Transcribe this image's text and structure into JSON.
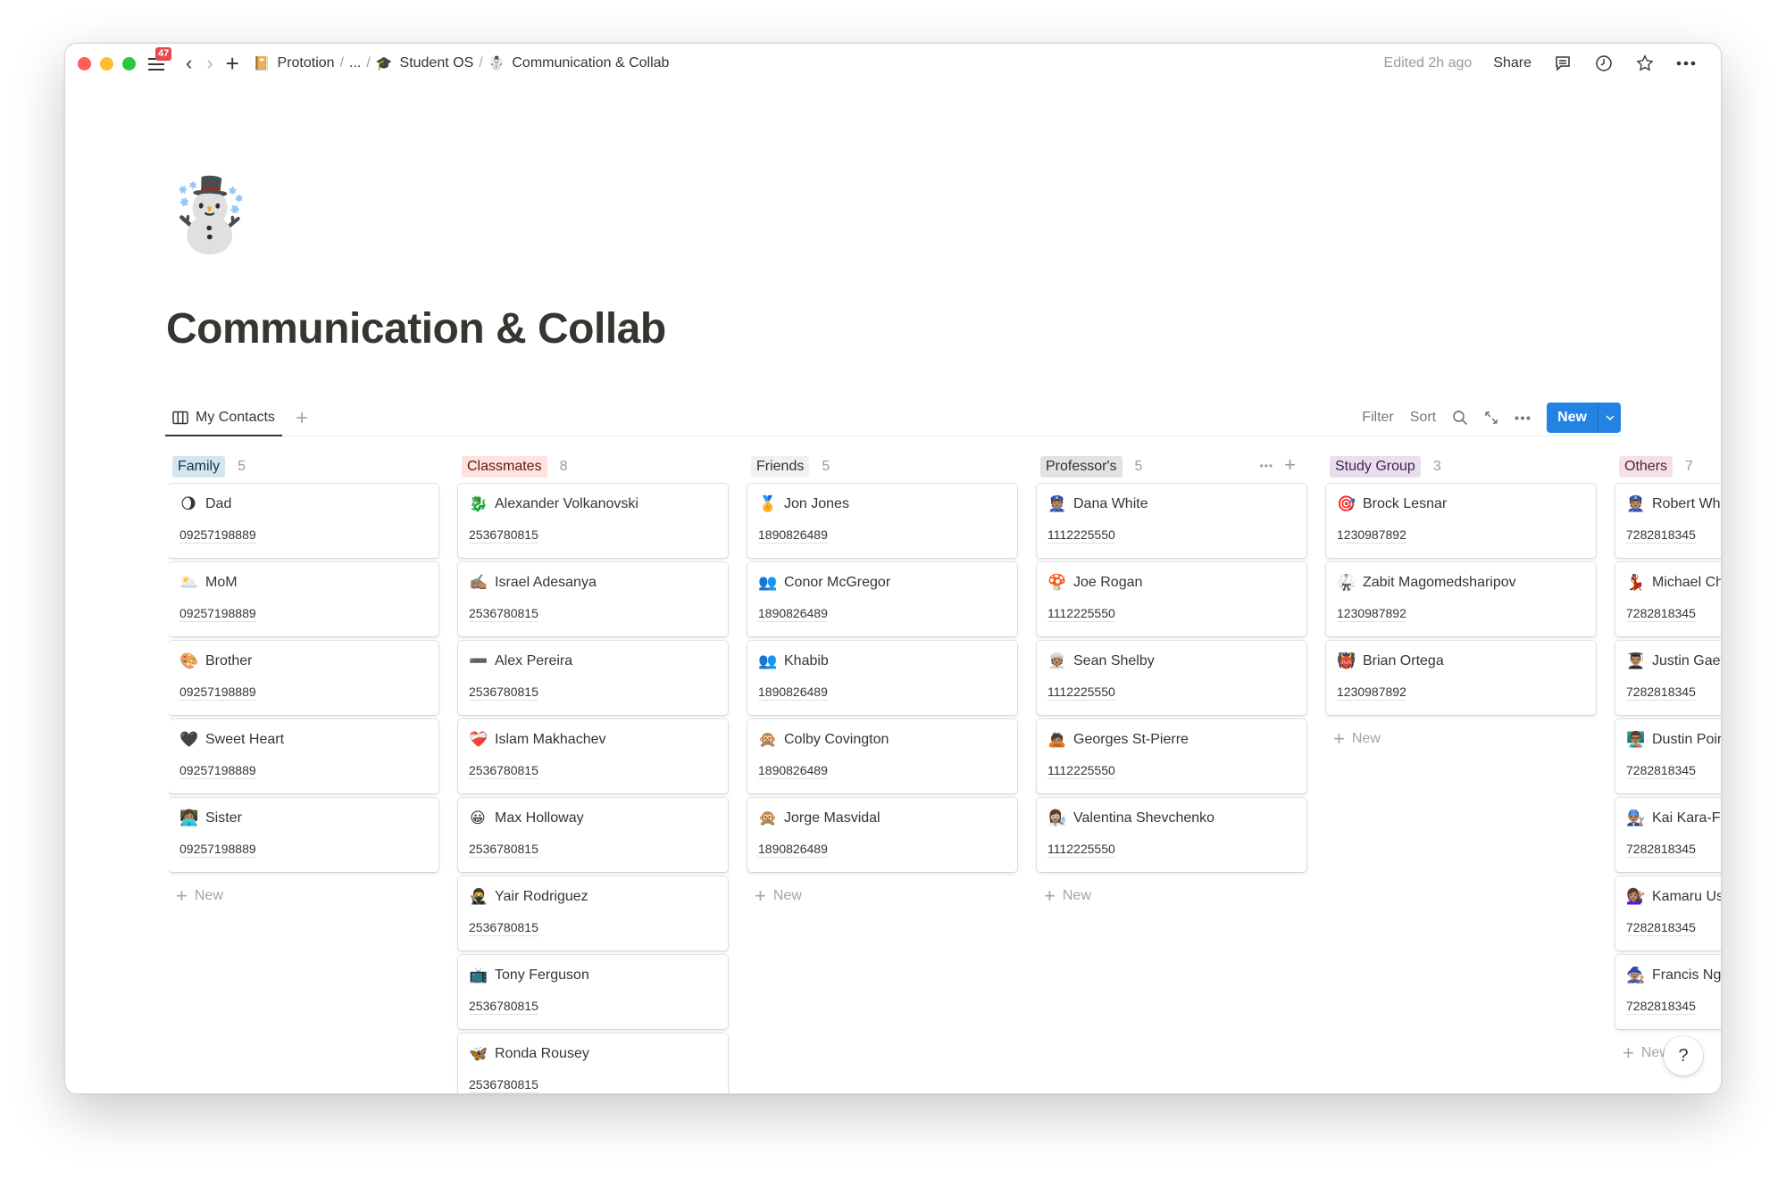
{
  "titlebar": {
    "notification_count": "47",
    "breadcrumb": [
      {
        "icon": "📔",
        "label": "Prototion"
      },
      {
        "icon": "",
        "label": "..."
      },
      {
        "icon": "🎓",
        "label": "Student OS"
      },
      {
        "icon": "☃️",
        "label": "Communication & Collab"
      }
    ],
    "edited": "Edited 2h ago",
    "share_label": "Share"
  },
  "page": {
    "icon": "☃️",
    "title": "Communication & Collab"
  },
  "views": {
    "active_tab": "My Contacts",
    "toolbar": {
      "filter": "Filter",
      "sort": "Sort",
      "new_label": "New"
    }
  },
  "board": {
    "add_new_label": "New",
    "columns": [
      {
        "name": "Family",
        "count": "5",
        "tag_bg": "#d3e5ef",
        "tag_fg": "#183347",
        "cards": [
          {
            "emoji": "🌖",
            "name": "Dad",
            "phone": "09257198889"
          },
          {
            "emoji": "🌥️",
            "name": "MoM",
            "phone": "09257198889"
          },
          {
            "emoji": "🎨",
            "name": "Brother",
            "phone": "09257198889"
          },
          {
            "emoji": "🖤",
            "name": "Sweet Heart",
            "phone": "09257198889"
          },
          {
            "emoji": "👩🏽‍💻",
            "name": "Sister",
            "phone": "09257198889"
          }
        ]
      },
      {
        "name": "Classmates",
        "count": "8",
        "tag_bg": "#ffe2dd",
        "tag_fg": "#5d1715",
        "cards": [
          {
            "emoji": "🐉",
            "name": "Alexander Volkanovski",
            "phone": "2536780815"
          },
          {
            "emoji": "✍🏽",
            "name": "Israel Adesanya",
            "phone": "2536780815"
          },
          {
            "emoji": "➖",
            "name": "Alex Pereira",
            "phone": "2536780815"
          },
          {
            "emoji": "❤️‍🩹",
            "name": "Islam Makhachev",
            "phone": "2536780815"
          },
          {
            "emoji": "😀",
            "name": "Max Holloway",
            "phone": "2536780815"
          },
          {
            "emoji": "🥷",
            "name": "Yair Rodriguez",
            "phone": "2536780815"
          },
          {
            "emoji": "📺",
            "name": "Tony Ferguson",
            "phone": "2536780815"
          },
          {
            "emoji": "🦋",
            "name": "Ronda Rousey",
            "phone": "2536780815"
          }
        ]
      },
      {
        "name": "Friends",
        "count": "5",
        "tag_bg": "#f1f1ef",
        "tag_fg": "#32302c",
        "cards": [
          {
            "emoji": "🏅",
            "name": "Jon Jones",
            "phone": "1890826489"
          },
          {
            "emoji": "👥",
            "name": "Conor McGregor",
            "phone": "1890826489"
          },
          {
            "emoji": "👥",
            "name": "Khabib",
            "phone": "1890826489"
          },
          {
            "emoji": "🙊",
            "name": "Colby Covington",
            "phone": "1890826489"
          },
          {
            "emoji": "🙊",
            "name": "Jorge Masvidal",
            "phone": "1890826489"
          }
        ]
      },
      {
        "name": "Professor's",
        "count": "5",
        "tag_bg": "#e3e2e0",
        "tag_fg": "#32302c",
        "cards": [
          {
            "emoji": "👮🏽",
            "name": "Dana White",
            "phone": "1112225550"
          },
          {
            "emoji": "🍄",
            "name": "Joe Rogan",
            "phone": "1112225550"
          },
          {
            "emoji": "👳🏽",
            "name": "Sean Shelby",
            "phone": "1112225550"
          },
          {
            "emoji": "🙇🏽",
            "name": "Georges St-Pierre",
            "phone": "1112225550"
          },
          {
            "emoji": "👩🏽‍🔬",
            "name": "Valentina Shevchenko",
            "phone": "1112225550"
          }
        ]
      },
      {
        "name": "Study Group",
        "count": "3",
        "tag_bg": "#e8deee",
        "tag_fg": "#412454",
        "cards": [
          {
            "emoji": "🎯",
            "name": "Brock Lesnar",
            "phone": "1230987892"
          },
          {
            "emoji": "🥋",
            "name": "Zabit Magomedsharipov",
            "phone": "1230987892"
          },
          {
            "emoji": "👹",
            "name": "Brian Ortega",
            "phone": "1230987892"
          }
        ]
      },
      {
        "name": "Others",
        "count": "7",
        "tag_bg": "#f5e0e9",
        "tag_fg": "#4c2337",
        "cards": [
          {
            "emoji": "👮🏽",
            "name": "Robert Whittaker",
            "phone": "7282818345"
          },
          {
            "emoji": "💃🏽",
            "name": "Michael Chandler",
            "phone": "7282818345"
          },
          {
            "emoji": "👨🏽‍🎓",
            "name": "Justin Gaethje",
            "phone": "7282818345"
          },
          {
            "emoji": "👨🏽‍🏫",
            "name": "Dustin Poirier",
            "phone": "7282818345"
          },
          {
            "emoji": "👨🏽‍🔧",
            "name": "Kai Kara-France",
            "phone": "7282818345"
          },
          {
            "emoji": "💇🏽‍♀️",
            "name": "Kamaru Usman",
            "phone": "7282818345"
          },
          {
            "emoji": "🧙🏽",
            "name": "Francis Ngannou",
            "phone": "7282818345"
          }
        ]
      }
    ]
  },
  "help_label": "?"
}
